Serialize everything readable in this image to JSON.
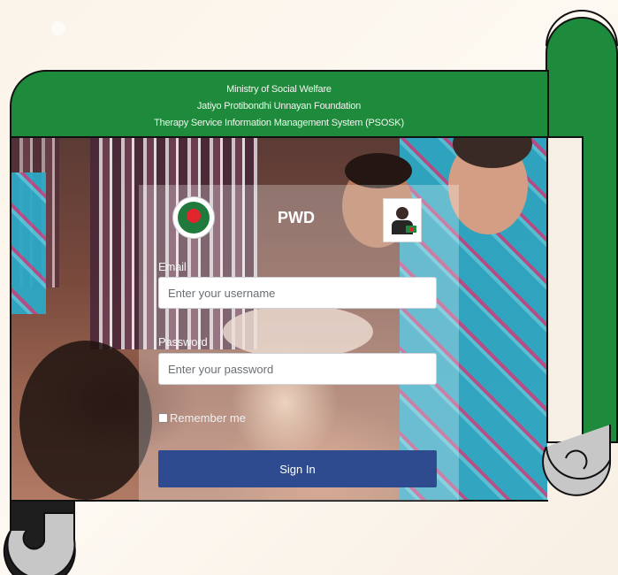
{
  "header": {
    "line1": "Ministry of Social Welfare",
    "line2": "Jatiyo Protibondhi Unnayan Foundation",
    "line3": "Therapy Service Information Management System (PSOSK)"
  },
  "login": {
    "title": "PWD",
    "email_label": "Email",
    "email_placeholder": "Enter your username",
    "password_label": "Password",
    "password_placeholder": "Enter your password",
    "remember_label": "Remember me",
    "signin_label": "Sign In"
  },
  "colors": {
    "scroll_green": "#1e8a3c",
    "scroll_curl": "#c7c7c7",
    "button": "#2e4b8f"
  }
}
